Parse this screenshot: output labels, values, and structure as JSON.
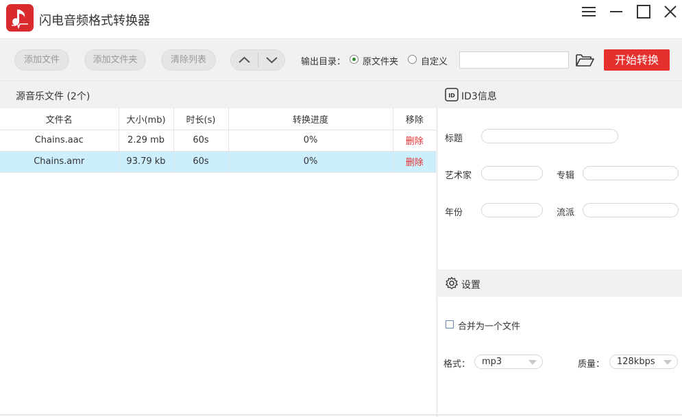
{
  "app": {
    "title": "闪电音频格式转换器",
    "accent_color": "#e5302e",
    "window_controls": [
      "menu-icon",
      "minimize-icon",
      "maximize-icon",
      "close-icon"
    ]
  },
  "toolbar": {
    "add_file": "添加文件",
    "add_folder": "添加文件夹",
    "clear_list": "清除列表",
    "move_up_icon": "chevron-up-icon",
    "move_down_icon": "chevron-down-icon",
    "output_dir_label": "输出目录：",
    "radio_source": "原文件夹",
    "radio_custom": "自定义",
    "selected_output": "原文件夹",
    "path_value": "",
    "browse_icon": "folder-open-icon",
    "start_label": "开始转换"
  },
  "file_list": {
    "header": "源音乐文件 (2个)",
    "columns": [
      "文件名",
      "大小(mb)",
      "时长(s)",
      "转换进度",
      "移除"
    ],
    "rows": [
      {
        "name": "Chains.aac",
        "size": "2.29 mb",
        "duration": "60s",
        "progress": "0%",
        "remove": "删除",
        "selected": false
      },
      {
        "name": "Chains.amr",
        "size": "93.79 kb",
        "duration": "60s",
        "progress": "0%",
        "remove": "删除",
        "selected": true
      }
    ]
  },
  "id3": {
    "header": "ID3信息",
    "title_label": "标题",
    "artist_label": "艺术家",
    "album_label": "专辑",
    "year_label": "年份",
    "genre_label": "流派",
    "title_value": "",
    "artist_value": "",
    "album_value": "",
    "year_value": "",
    "genre_value": ""
  },
  "settings": {
    "header": "设置",
    "merge_label": "合并为一个文件",
    "merge_checked": false,
    "format_label": "格式：",
    "format_value": "mp3",
    "quality_label": "质量：",
    "quality_value": "128kbps"
  }
}
